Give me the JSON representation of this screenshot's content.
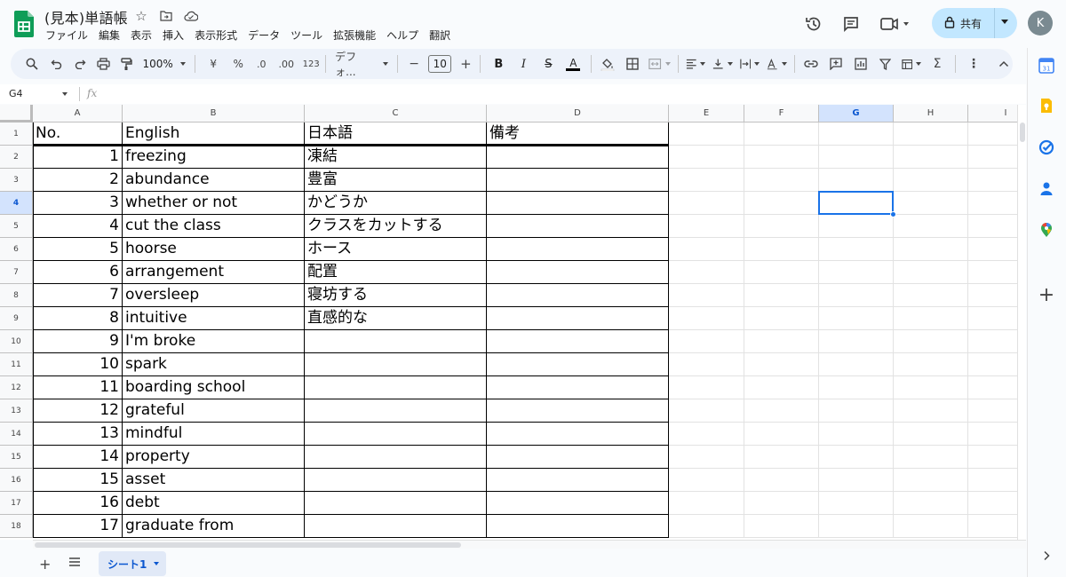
{
  "document": {
    "title": "(見本)単語帳"
  },
  "menu": [
    "ファイル",
    "編集",
    "表示",
    "挿入",
    "表示形式",
    "データ",
    "ツール",
    "拡張機能",
    "ヘルプ",
    "翻訳"
  ],
  "share": {
    "label": "共有"
  },
  "avatar": {
    "initial": "K"
  },
  "toolbar": {
    "zoom": "100%",
    "currency": "¥",
    "percent": "%",
    "dec_decrease": ".0",
    "dec_increase": ".00",
    "number_format": "123",
    "font": "デフォ...",
    "font_size": "10",
    "minus": "−",
    "plus": "+"
  },
  "formula_bar": {
    "cell_ref": "G4",
    "fx": "fx",
    "value": ""
  },
  "columns": [
    "A",
    "B",
    "C",
    "D",
    "E",
    "F",
    "G",
    "H",
    "I"
  ],
  "selected_column": "G",
  "selected_row": "4",
  "rows": [
    "1",
    "2",
    "3",
    "4",
    "5",
    "6",
    "7",
    "8",
    "9",
    "10",
    "11",
    "12",
    "13",
    "14",
    "15",
    "16",
    "17",
    "18"
  ],
  "table": {
    "headers": [
      "No.",
      "English",
      "日本語",
      "備考"
    ],
    "entries": [
      {
        "no": "1",
        "en": "freezing",
        "ja": "凍結"
      },
      {
        "no": "2",
        "en": "abundance",
        "ja": "豊富"
      },
      {
        "no": "3",
        "en": "whether or not",
        "ja": "かどうか"
      },
      {
        "no": "4",
        "en": "cut the class",
        "ja": "クラスをカットする"
      },
      {
        "no": "5",
        "en": "hoorse",
        "ja": "ホース"
      },
      {
        "no": "6",
        "en": "arrangement",
        "ja": "配置"
      },
      {
        "no": "7",
        "en": "oversleep",
        "ja": "寝坊する"
      },
      {
        "no": "8",
        "en": "intuitive",
        "ja": "直感的な"
      },
      {
        "no": "9",
        "en": "I'm broke",
        "ja": ""
      },
      {
        "no": "10",
        "en": "spark",
        "ja": ""
      },
      {
        "no": "11",
        "en": "boarding school",
        "ja": ""
      },
      {
        "no": "12",
        "en": "grateful",
        "ja": ""
      },
      {
        "no": "13",
        "en": "mindful",
        "ja": ""
      },
      {
        "no": "14",
        "en": "property",
        "ja": ""
      },
      {
        "no": "15",
        "en": "asset",
        "ja": ""
      },
      {
        "no": "16",
        "en": "debt",
        "ja": ""
      },
      {
        "no": "17",
        "en": "graduate from",
        "ja": ""
      }
    ]
  },
  "sheets": [
    {
      "name": "シート1",
      "active": true
    }
  ],
  "colors": {
    "accent": "#1a73e8",
    "share_bg": "#c2e7ff",
    "toolbar_bg": "#edf2fa"
  }
}
